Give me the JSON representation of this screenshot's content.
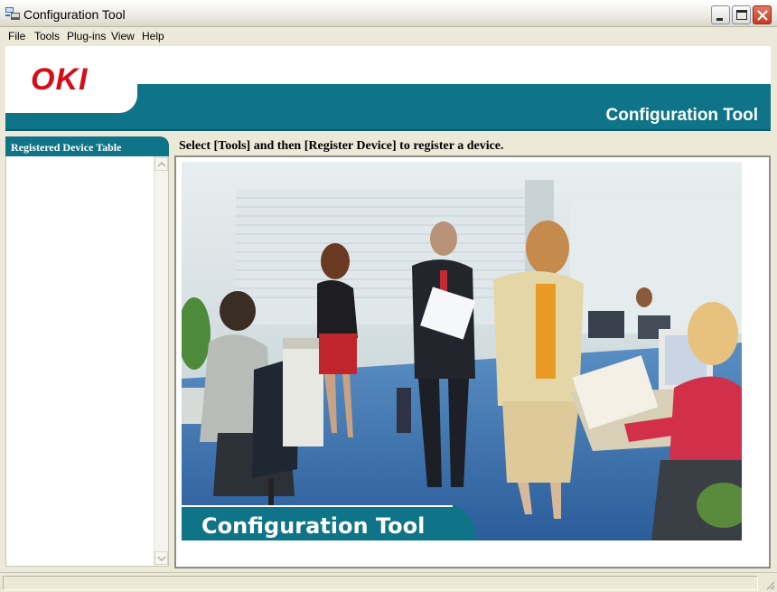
{
  "window": {
    "title": "Configuration Tool",
    "icon": "configuration-tool-app-icon",
    "controls": [
      "minimize-icon",
      "maximize-icon",
      "close-icon"
    ]
  },
  "menu": {
    "items": [
      "File",
      "Tools",
      "Plug-ins",
      "View",
      "Help"
    ]
  },
  "banner": {
    "logo": "OKI",
    "title": "Configuration Tool",
    "accent_color": "#0f7487",
    "logo_color": "#d80c18"
  },
  "sidebar": {
    "header": "Registered Device Table",
    "items": []
  },
  "main": {
    "instruction": "Select [Tools] and then [Register Device] to register a device.",
    "image_caption": "Configuration Tool"
  },
  "statusbar": {
    "text": ""
  }
}
